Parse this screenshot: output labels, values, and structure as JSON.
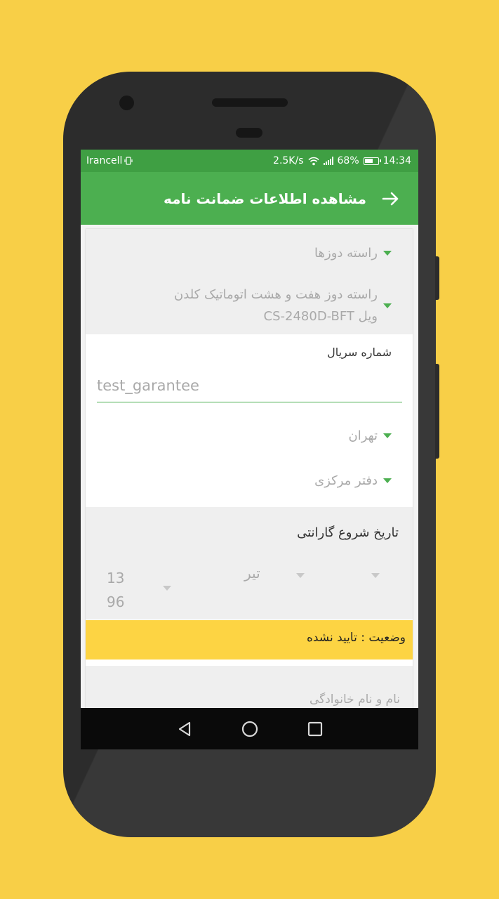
{
  "status_bar": {
    "carrier": "Irancell",
    "network_speed": "2.5K/s",
    "battery": "68%",
    "battery_level": 0.68,
    "time": "14:34"
  },
  "app_bar": {
    "title": "مشاهده اطلاعات ضمانت نامه",
    "back_icon": "arrow-right-icon"
  },
  "form": {
    "category": "راسته دوزها",
    "product_line1": "راسته دوز هفت و هشت اتوماتیک کلدن",
    "product_line2": "ویل CS-2480D-BFT",
    "serial_label": "شماره سریال",
    "serial_value": "test_garantee",
    "city": "تهران",
    "branch": "دفتر مرکزی",
    "warranty_start_label": "تاریخ شروع گارانتی",
    "date_month": "تیر",
    "date_year_line1": "13",
    "date_year_line2": "96",
    "status_text": "وضعیت : تایید نشده",
    "name_label": "نام و نام خانوادگی"
  },
  "colors": {
    "background": "#f8cf47",
    "status_bar": "#3f9f43",
    "app_bar": "#4caf50",
    "status_strip": "#fdd443"
  },
  "nav": {
    "back": "triangle-back-icon",
    "home": "circle-home-icon",
    "recents": "square-recents-icon"
  }
}
